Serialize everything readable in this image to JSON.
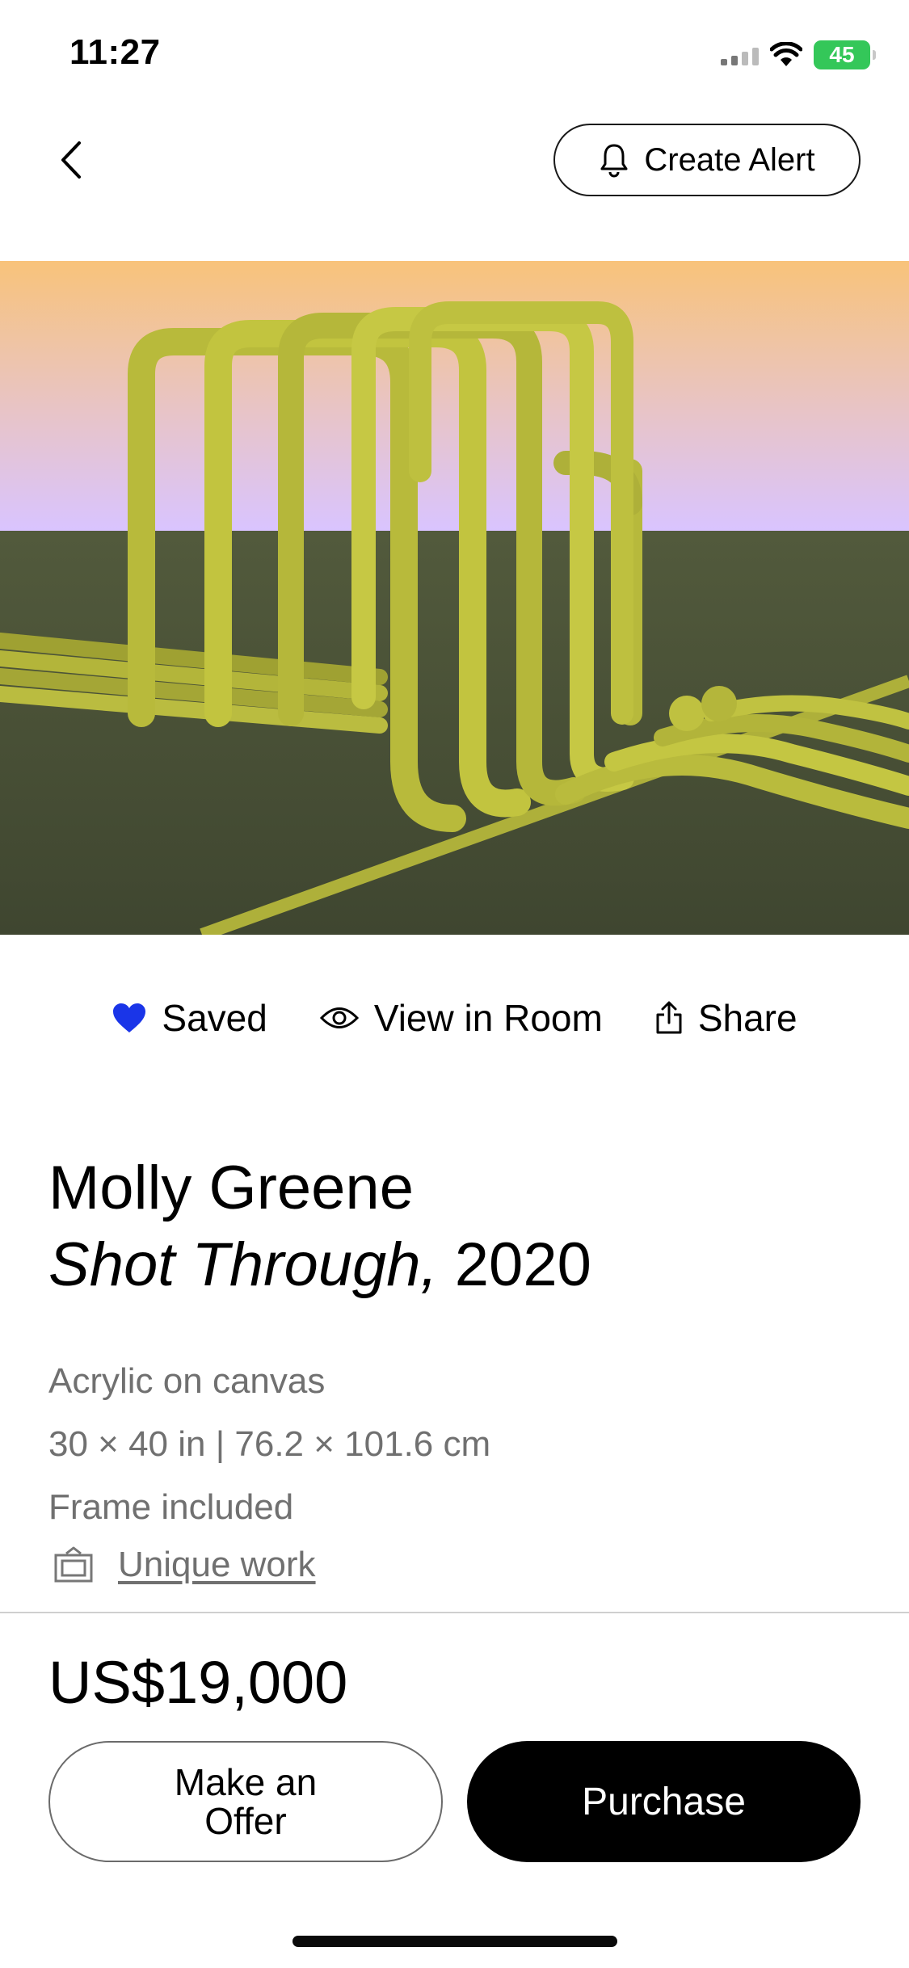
{
  "status_bar": {
    "time": "11:27",
    "battery_level": "45"
  },
  "header": {
    "back_icon": "chevron-left-icon",
    "create_alert_label": "Create Alert",
    "create_alert_icon": "bell-icon"
  },
  "actions": [
    {
      "label": "Saved",
      "icon": "heart-filled-icon",
      "color": "#1a35e8"
    },
    {
      "label": "View in Room",
      "icon": "eye-icon"
    },
    {
      "label": "Share",
      "icon": "share-icon"
    }
  ],
  "artwork": {
    "artist": "Molly Greene",
    "title": "Shot Through,",
    "year": "2020",
    "medium": "Acrylic on canvas",
    "dimensions": "30 × 40 in | 76.2 × 101.6 cm",
    "frame": "Frame included",
    "rarity_label": "Unique work",
    "rarity_icon": "frame-icon"
  },
  "purchase": {
    "price": "US$19,000",
    "offer_label": "Make an Offer",
    "purchase_label": "Purchase"
  },
  "colors": {
    "accent_blue": "#1a35e8",
    "tube_green": "#c2c23a",
    "ground_green": "#4a5236",
    "sky_top": "#f8c37a",
    "sky_bottom": "#d9c4ff"
  }
}
